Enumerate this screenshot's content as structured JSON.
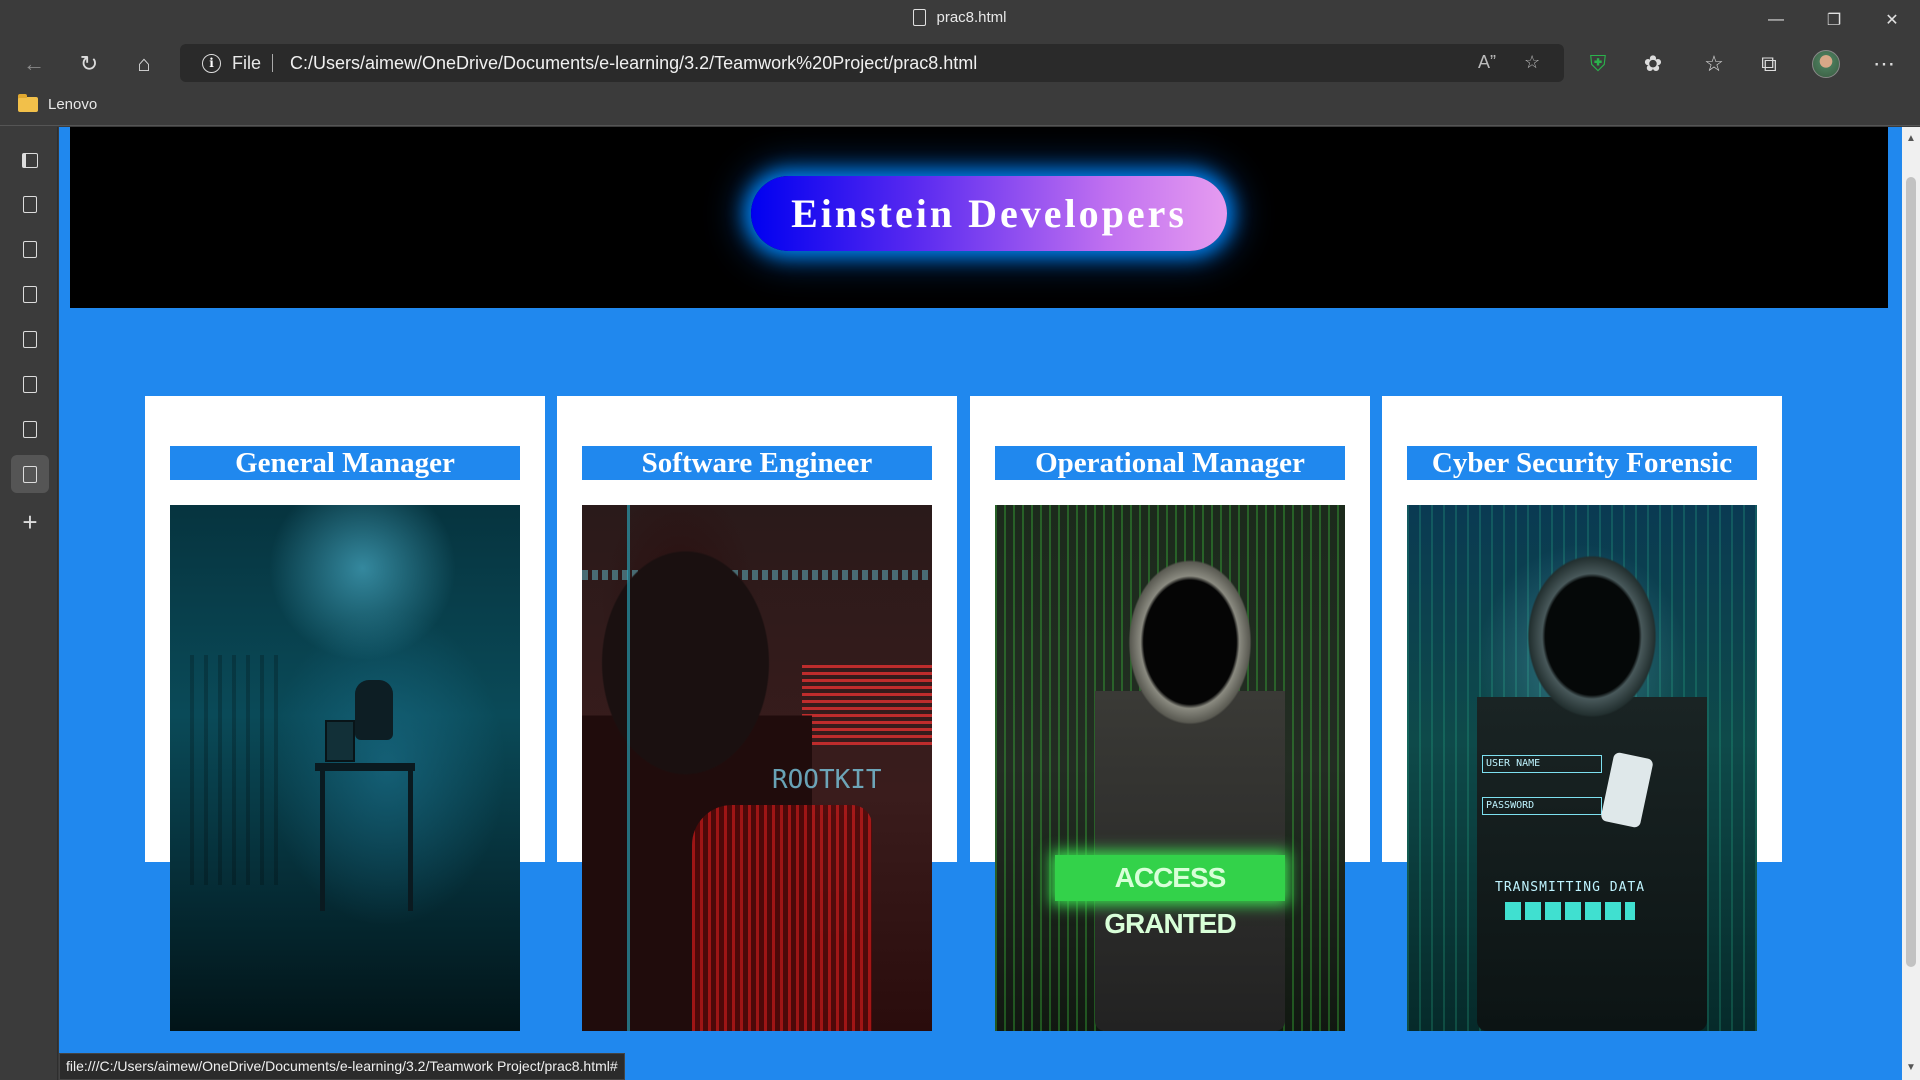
{
  "window": {
    "tab_title": "prac8.html",
    "controls": [
      "minimize",
      "restore",
      "close"
    ]
  },
  "toolbar": {
    "back_icon": "back-arrow-icon",
    "refresh_icon": "refresh-icon",
    "home_icon": "home-icon",
    "address": {
      "protocol_label": "File",
      "url": "C:/Users/aimew/OneDrive/Documents/e-learning/3.2/Teamwork%20Project/prac8.html"
    },
    "right_icons": [
      "read-aloud-icon",
      "add-favorite-icon",
      "browser-essentials-icon",
      "extensions-icon",
      "favorites-icon",
      "collections-icon",
      "profile-avatar",
      "more-menu-icon"
    ]
  },
  "bookmarks": {
    "items": [
      {
        "label": "Lenovo",
        "icon": "folder-icon"
      }
    ]
  },
  "sidebar": {
    "tabs": [
      "tab-actions-icon",
      "page-icon",
      "page-icon",
      "page-icon",
      "page-icon",
      "page-icon",
      "page-icon",
      "page-icon"
    ],
    "active_index": 7,
    "new_tab_icon": "plus-icon"
  },
  "page": {
    "banner_title": "Einstein Developers",
    "cards": [
      {
        "title": "General Manager",
        "image": "hooded figure at desk in dark teal room"
      },
      {
        "title": "Software Engineer",
        "image": "hooded figure with red code overlay"
      },
      {
        "title": "Operational Manager",
        "image": "hooded figure with green code",
        "image_text": "ACCESS GRANTED"
      },
      {
        "title": "Cyber Security Forensic",
        "image": "hooded figure holding phone",
        "image_fields": [
          "USER NAME",
          "PASSWORD"
        ],
        "image_text": "TRANSMITTING DATA"
      }
    ],
    "colors": {
      "page_background": "#2088ee",
      "banner_background": "#000000",
      "pill_gradient_start": "#0000f0",
      "pill_gradient_end": "#e69cf0",
      "card_background": "#ffffff"
    }
  },
  "status_bar": {
    "text": "file:///C:/Users/aimew/OneDrive/Documents/e-learning/3.2/Teamwork Project/prac8.html#"
  }
}
